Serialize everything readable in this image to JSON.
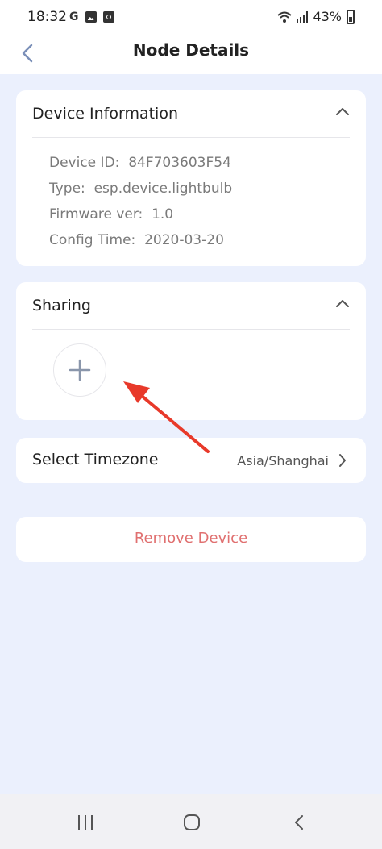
{
  "status_bar": {
    "time": "18:32",
    "left_icons": [
      "google-icon",
      "gallery-icon",
      "cast-icon"
    ],
    "g_letter": "G",
    "battery_percent": "43%",
    "right_icons": [
      "wifi-icon",
      "signal-icon",
      "battery-icon"
    ]
  },
  "header": {
    "title": "Node Details",
    "back_icon": "chevron-left-icon"
  },
  "device_info": {
    "title": "Device Information",
    "rows": [
      {
        "label": "Device ID:",
        "value": "84F703603F54"
      },
      {
        "label": "Type:",
        "value": "esp.device.lightbulb"
      },
      {
        "label": "Firmware ver:",
        "value": "1.0"
      },
      {
        "label": "Config Time:",
        "value": "2020-03-20"
      }
    ]
  },
  "sharing": {
    "title": "Sharing",
    "add_icon": "plus-icon"
  },
  "timezone": {
    "label": "Select Timezone",
    "value": "Asia/Shanghai"
  },
  "remove_device": {
    "label": "Remove Device"
  },
  "colors": {
    "background": "#ebf0fd",
    "card": "#ffffff",
    "remove_text": "#e07070",
    "annotation_arrow": "#e8392a"
  },
  "nav_bar": {
    "icons": [
      "recent-apps-icon",
      "home-icon",
      "back-icon"
    ]
  }
}
